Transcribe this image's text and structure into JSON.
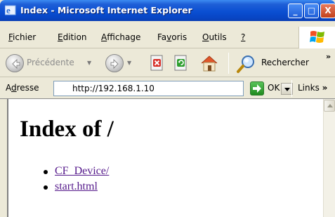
{
  "window": {
    "title": "Index - Microsoft Internet Explorer",
    "controls": {
      "minimize": "_",
      "maximize": "□",
      "close": "X"
    }
  },
  "menu": {
    "items": [
      {
        "label_underlined": "F",
        "label_rest": "ichier"
      },
      {
        "label_underlined": "E",
        "label_rest": "dition"
      },
      {
        "label_underlined": "A",
        "label_rest": "ffichage"
      },
      {
        "label_pre": "Fa",
        "label_underlined": "v",
        "label_rest": "oris"
      },
      {
        "label_underlined": "O",
        "label_rest": "utils"
      },
      {
        "label_underlined": "?",
        "label_rest": ""
      }
    ]
  },
  "toolbar": {
    "back_label": "Précédente",
    "search_label": "Rechercher",
    "more_chevron": "»"
  },
  "address": {
    "label_pre": "A",
    "label_underlined": "d",
    "label_rest": "resse",
    "url": "http://192.168.1.10",
    "go_label": "OK",
    "links_label": "Links",
    "links_chevron": "»"
  },
  "page": {
    "heading": "Index of /",
    "entries": [
      "CF_Device/",
      "start.html"
    ]
  }
}
